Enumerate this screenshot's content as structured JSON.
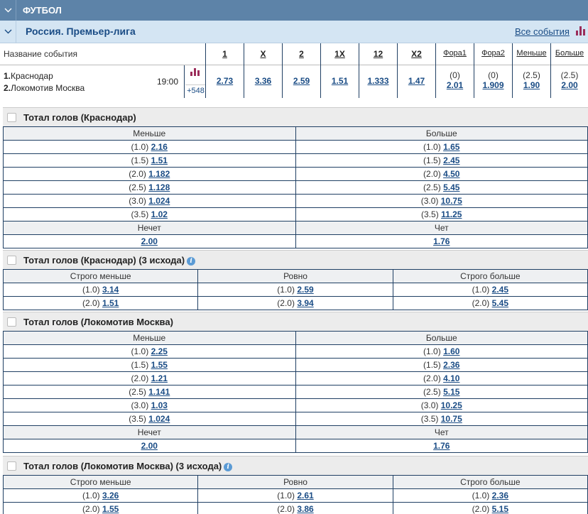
{
  "sport": {
    "title": "ФУТБОЛ"
  },
  "league": {
    "title": "Россия. Премьер-лига",
    "all_events": "Все события"
  },
  "columns": {
    "event_name": "Название события",
    "c1": "1",
    "cX": "X",
    "c2": "2",
    "c1X": "1X",
    "c12": "12",
    "cX2": "X2",
    "fora1": "Фора1",
    "fora2": "Фора2",
    "less": "Меньше",
    "more": "Больше"
  },
  "event": {
    "team1_num": "1.",
    "team1": "Краснодар",
    "team2_num": "2.",
    "team2": "Локомотив Москва",
    "time": "19:00",
    "more_markets": "+548",
    "odds": {
      "c1": "2.73",
      "cX": "3.36",
      "c2": "2.59",
      "c1X": "1.51",
      "c12": "1.333",
      "cX2": "1.47"
    },
    "fora1": {
      "param": "(0)",
      "odd": "2.01"
    },
    "fora2": {
      "param": "(0)",
      "odd": "1.909"
    },
    "less": {
      "param": "(2.5)",
      "odd": "1.90"
    },
    "more": {
      "param": "(2.5)",
      "odd": "2.00"
    }
  },
  "market1": {
    "title": "Тотал голов (Краснодар)",
    "less_label": "Меньше",
    "more_label": "Больше",
    "rows": [
      {
        "lp": "(1.0)",
        "lo": "2.16",
        "mp": "(1.0)",
        "mo": "1.65"
      },
      {
        "lp": "(1.5)",
        "lo": "1.51",
        "mp": "(1.5)",
        "mo": "2.45"
      },
      {
        "lp": "(2.0)",
        "lo": "1.182",
        "mp": "(2.0)",
        "mo": "4.50"
      },
      {
        "lp": "(2.5)",
        "lo": "1.128",
        "mp": "(2.5)",
        "mo": "5.45"
      },
      {
        "lp": "(3.0)",
        "lo": "1.024",
        "mp": "(3.0)",
        "mo": "10.75"
      },
      {
        "lp": "(3.5)",
        "lo": "1.02",
        "mp": "(3.5)",
        "mo": "11.25"
      }
    ],
    "odd_label": "Нечет",
    "even_label": "Чет",
    "odd_value": "2.00",
    "even_value": "1.76"
  },
  "market2": {
    "title": "Тотал голов (Краснодар) (3 исхода)",
    "h1": "Строго меньше",
    "h2": "Ровно",
    "h3": "Строго больше",
    "rows": [
      {
        "p1": "(1.0)",
        "o1": "3.14",
        "p2": "(1.0)",
        "o2": "2.59",
        "p3": "(1.0)",
        "o3": "2.45"
      },
      {
        "p1": "(2.0)",
        "o1": "1.51",
        "p2": "(2.0)",
        "o2": "3.94",
        "p3": "(2.0)",
        "o3": "5.45"
      }
    ]
  },
  "market3": {
    "title": "Тотал голов (Локомотив Москва)",
    "less_label": "Меньше",
    "more_label": "Больше",
    "rows": [
      {
        "lp": "(1.0)",
        "lo": "2.25",
        "mp": "(1.0)",
        "mo": "1.60"
      },
      {
        "lp": "(1.5)",
        "lo": "1.55",
        "mp": "(1.5)",
        "mo": "2.36"
      },
      {
        "lp": "(2.0)",
        "lo": "1.21",
        "mp": "(2.0)",
        "mo": "4.10"
      },
      {
        "lp": "(2.5)",
        "lo": "1.141",
        "mp": "(2.5)",
        "mo": "5.15"
      },
      {
        "lp": "(3.0)",
        "lo": "1.03",
        "mp": "(3.0)",
        "mo": "10.25"
      },
      {
        "lp": "(3.5)",
        "lo": "1.024",
        "mp": "(3.5)",
        "mo": "10.75"
      }
    ],
    "odd_label": "Нечет",
    "even_label": "Чет",
    "odd_value": "2.00",
    "even_value": "1.76"
  },
  "market4": {
    "title": "Тотал голов (Локомотив Москва) (3 исхода)",
    "h1": "Строго меньше",
    "h2": "Ровно",
    "h3": "Строго больше",
    "rows": [
      {
        "p1": "(1.0)",
        "o1": "3.26",
        "p2": "(1.0)",
        "o2": "2.61",
        "p3": "(1.0)",
        "o3": "2.36"
      },
      {
        "p1": "(2.0)",
        "o1": "1.55",
        "p2": "(2.0)",
        "o2": "3.86",
        "p3": "(2.0)",
        "o3": "5.15"
      }
    ]
  }
}
